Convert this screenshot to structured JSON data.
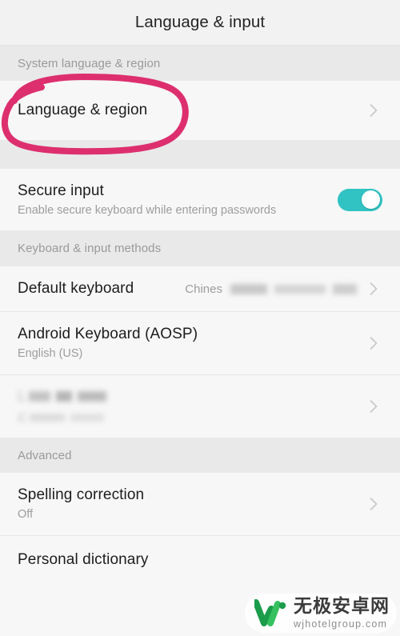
{
  "header": {
    "title": "Language & input"
  },
  "sections": [
    {
      "id": "system-language-region",
      "label": "System language & region",
      "rows": [
        {
          "id": "language-region",
          "title": "Language & region",
          "subtitle": "",
          "value": "",
          "control": "chevron",
          "highlighted": true
        }
      ]
    },
    {
      "id": "secure-input-section",
      "label": "",
      "rows": [
        {
          "id": "secure-input",
          "title": "Secure input",
          "subtitle": "Enable secure keyboard while entering passwords",
          "value": "",
          "control": "toggle",
          "toggle_on": true
        }
      ]
    },
    {
      "id": "keyboard-input-methods",
      "label": "Keyboard & input methods",
      "rows": [
        {
          "id": "default-keyboard",
          "title": "Default keyboard",
          "subtitle": "",
          "value": "Chines",
          "value_redacted": true,
          "control": "chevron"
        },
        {
          "id": "android-keyboard-aosp",
          "title": "Android Keyboard (AOSP)",
          "subtitle": "English (US)",
          "value": "",
          "control": "chevron"
        },
        {
          "id": "redacted-keyboard",
          "title": "L",
          "title_redacted": true,
          "subtitle": "C",
          "subtitle_redacted": true,
          "value": "",
          "control": "chevron"
        }
      ]
    },
    {
      "id": "advanced",
      "label": "Advanced",
      "rows": [
        {
          "id": "spelling-correction",
          "title": "Spelling correction",
          "subtitle": "Off",
          "value": "",
          "control": "chevron"
        },
        {
          "id": "personal-dictionary",
          "title": "Personal dictionary",
          "subtitle": "",
          "value": "",
          "control": "none"
        }
      ]
    }
  ],
  "annotation": {
    "kind": "hand-drawn-oval",
    "targets": "language-region",
    "color": "#dd2f6e",
    "stroke_width": 8
  },
  "watermark": {
    "brand_cn": "无极安卓网",
    "url": "wjhotelgroup.com",
    "logo_color_dark": "#1a9c4b",
    "logo_color_light": "#35c15f"
  },
  "colors": {
    "page_background": "#f7f7f7",
    "appbar_background": "#f2f2f2",
    "section_header_background": "#e9e9e9",
    "title_text": "#1d1d1d",
    "secondary_text": "#9d9d9d",
    "divider": "#e6e6e6",
    "toggle_on": "#31c3c3",
    "chevron": "#cccccc",
    "annotation_pink": "#dd2f6e"
  }
}
